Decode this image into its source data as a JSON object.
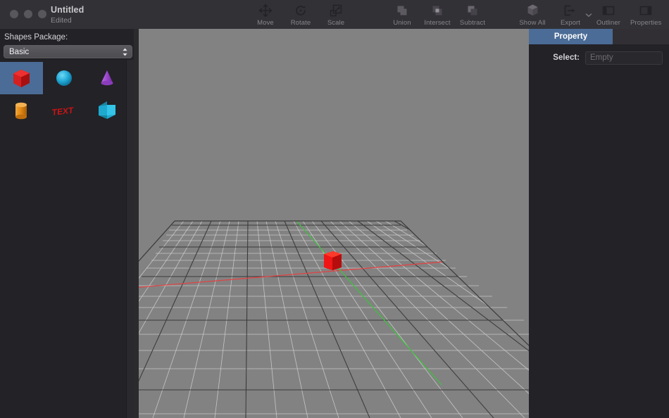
{
  "window": {
    "title": "Untitled",
    "subtitle": "Edited",
    "traffic_lights": [
      "close",
      "minimize",
      "zoom"
    ]
  },
  "toolbar": {
    "transform_tools": [
      {
        "label": "Move",
        "icon": "move-icon"
      },
      {
        "label": "Rotate",
        "icon": "rotate-icon"
      },
      {
        "label": "Scale",
        "icon": "scale-icon"
      }
    ],
    "boolean_tools": [
      {
        "label": "Union",
        "icon": "union-icon"
      },
      {
        "label": "Intersect",
        "icon": "intersect-icon"
      },
      {
        "label": "Subtract",
        "icon": "subtract-icon"
      }
    ],
    "view_tools": [
      {
        "label": "Show All",
        "icon": "cube-icon"
      },
      {
        "label": "Export",
        "icon": "export-icon",
        "has_dropdown": true
      },
      {
        "label": "Outliner",
        "icon": "outliner-panel-icon"
      },
      {
        "label": "Properties",
        "icon": "properties-panel-icon"
      }
    ]
  },
  "sidebar": {
    "package_label": "Shapes Package:",
    "package_selected": "Basic",
    "package_options": [
      "Basic"
    ],
    "shapes": [
      {
        "name": "cube",
        "color": "#d81f1f",
        "selected": true
      },
      {
        "name": "sphere",
        "color": "#1fa8d8",
        "selected": false
      },
      {
        "name": "cone",
        "color": "#9b4fd0",
        "selected": false
      },
      {
        "name": "cylinder",
        "color": "#e08a1e",
        "selected": false
      },
      {
        "name": "text",
        "color": "#cc1818",
        "selected": false,
        "glyph": "TEXT"
      },
      {
        "name": "arrow",
        "color": "#23b4d8",
        "selected": false
      }
    ]
  },
  "right_panel": {
    "tabs": [
      {
        "label": "Property",
        "active": true
      }
    ],
    "select_label": "Select:",
    "select_value": "",
    "select_placeholder": "Empty"
  },
  "viewport": {
    "background_color": "#828282",
    "grid_minor_color": "#d2d2d2",
    "grid_major_color": "#3a3a3a",
    "axis_x_color": "#e04545",
    "axis_z_color": "#3fbf3f",
    "object": {
      "name": "cube",
      "color": "#ee1111",
      "selected": false
    }
  }
}
